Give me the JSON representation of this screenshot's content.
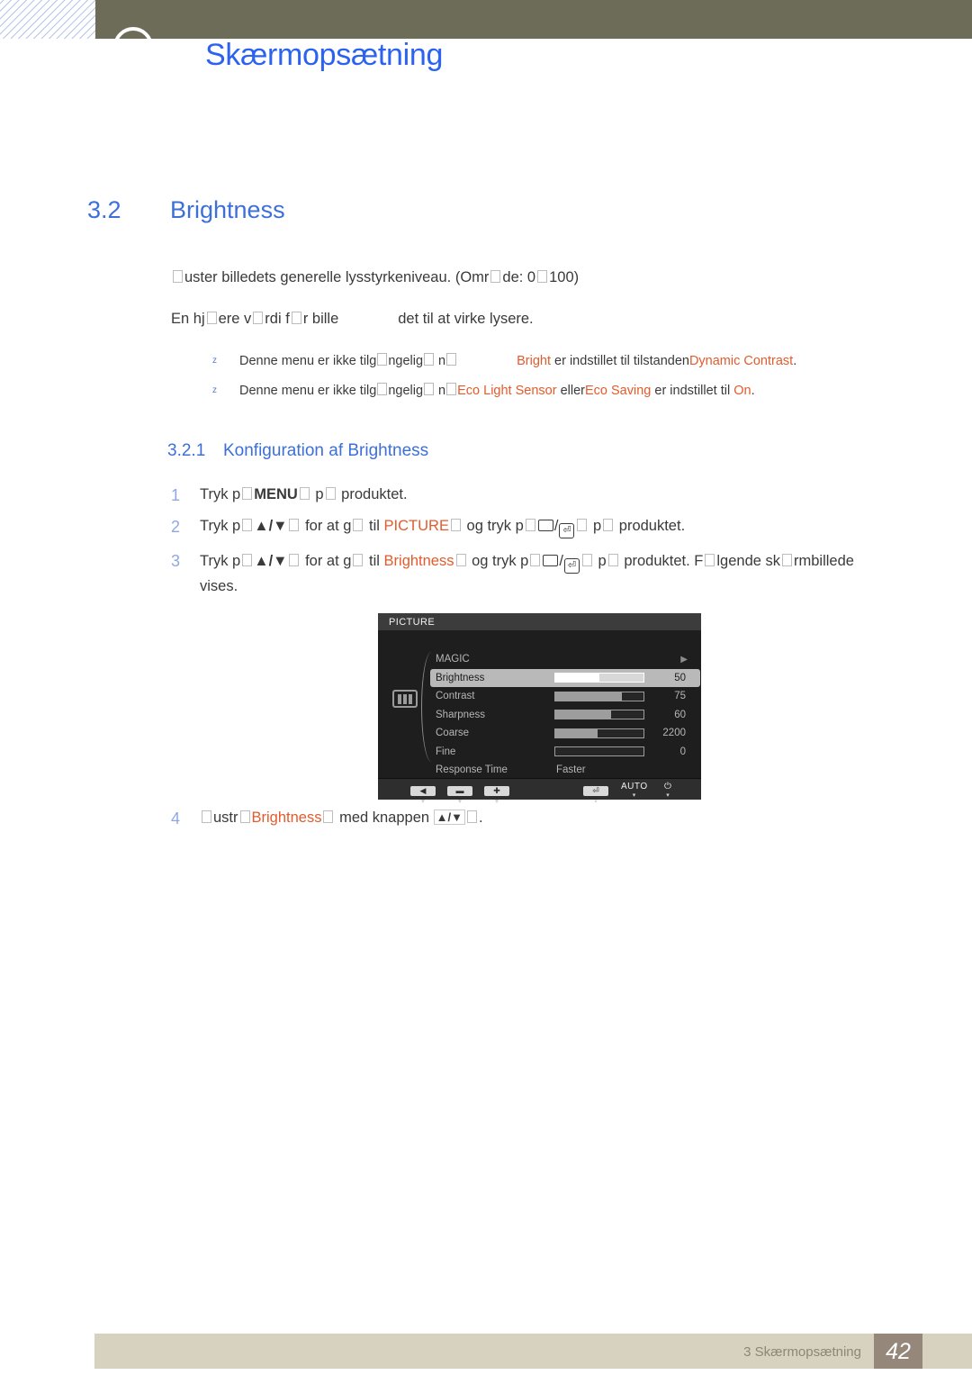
{
  "header": {
    "chapter_title": "Skærmopsætning",
    "olive_color": "#6d6c58",
    "accent_blue": "#2b62f0"
  },
  "section": {
    "number": "3.2",
    "title": "Brightness"
  },
  "intro": {
    "line1_a": "uster billedets generelle lysstyrkeniveau. (Omr",
    "line1_b": "de: 0",
    "line1_c": "100)",
    "line2_a": "En hj",
    "line2_b": "ere v",
    "line2_c": "rdi f",
    "line2_d": "r bille",
    "line2_e": "det til at virke lysere."
  },
  "notes": [
    {
      "marker": "z",
      "t1": "Denne menu er ikke tilg",
      "t2": "ngelig",
      "t3": " n",
      "t4": "",
      "orange1": "Bright",
      "t5": " er indstillet til tilstanden",
      "orange2": "Dynamic Contrast",
      "t6": "."
    },
    {
      "marker": "z",
      "t1": "Denne menu er ikke tilg",
      "t2": "ngelig",
      "t3": " n",
      "orange1": "Eco Light Sensor",
      "t5": " eller",
      "orange2": "Eco Saving",
      "t6": " er indstillet til ",
      "orange3": "On",
      "t7": "."
    }
  ],
  "subsection": {
    "number": "3.2.1",
    "title": "Konfiguration af Brightness"
  },
  "steps": [
    {
      "n": "1",
      "a": "Tryk p",
      "kbd": "MENU",
      "b": " p",
      "c": " produktet."
    },
    {
      "n": "2",
      "a": "Tryk p",
      "arrows": "▲/▼",
      "b": " for at g",
      "c": " til ",
      "orange": "PICTURE",
      "d": " og tryk p",
      "slash": "/",
      "enter": "⏎",
      "e": " p",
      "f": " produktet."
    },
    {
      "n": "3",
      "a": "Tryk p",
      "arrows": "▲/▼",
      "b": " for at g",
      "c": " til ",
      "orange": "Brightness",
      "d": " og tryk p",
      "slash": "/",
      "enter": "⏎",
      "e": " p",
      "f": " produktet. F",
      "g": "lgende sk",
      "h": "rmbillede vises."
    },
    {
      "n": "4",
      "a": "ustr",
      "orange": "Brightness",
      "b": " med knappen ",
      "arrows": "▲/▼",
      "c": "."
    }
  ],
  "osd": {
    "title": "PICTURE",
    "side_icon": "picture-bars-icon",
    "rows": [
      {
        "label": "MAGIC",
        "kind": "submenu",
        "arrow": "▶"
      },
      {
        "label": "Brightness",
        "kind": "slider",
        "value": "50",
        "fill_pct": 50,
        "selected": true
      },
      {
        "label": "Contrast",
        "kind": "slider",
        "value": "75",
        "fill_pct": 75,
        "selected": false
      },
      {
        "label": "Sharpness",
        "kind": "slider",
        "value": "60",
        "fill_pct": 63,
        "selected": false
      },
      {
        "label": "Coarse",
        "kind": "slider",
        "value": "2200",
        "fill_pct": 48,
        "selected": false
      },
      {
        "label": "Fine",
        "kind": "slider",
        "value": "0",
        "fill_pct": 0,
        "selected": false
      },
      {
        "label": "Response Time",
        "kind": "text",
        "value": "Faster",
        "selected": false
      }
    ],
    "footer_buttons": [
      {
        "name": "back-button",
        "glyph": "◀"
      },
      {
        "name": "minus-button",
        "glyph": "▬"
      },
      {
        "name": "plus-button",
        "glyph": "✚"
      },
      {
        "name": "enter-button",
        "glyph": "⏎"
      },
      {
        "name": "auto-button",
        "text": "AUTO"
      },
      {
        "name": "power-button",
        "text": "⏻"
      }
    ]
  },
  "footer": {
    "label": "3 Skærmopsætning",
    "page": "42",
    "bar_color": "#d6d2bf",
    "page_color": "#95887b"
  }
}
